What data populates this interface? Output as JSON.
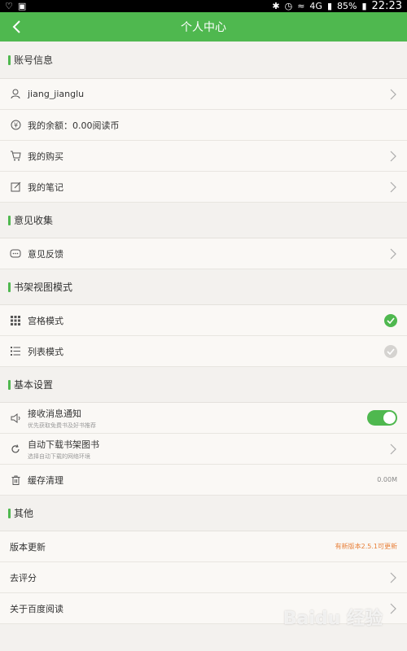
{
  "statusbar": {
    "battery": "85%",
    "network": "4G",
    "time": "22:23"
  },
  "titlebar": {
    "title": "个人中心"
  },
  "sections": {
    "account": {
      "title": "账号信息",
      "username": "jiang_jianglu",
      "balance": "我的余额：0.00阅读币",
      "purchases": "我的购买",
      "notes": "我的笔记"
    },
    "feedback": {
      "title": "意见收集",
      "feedback": "意见反馈"
    },
    "shelf_view": {
      "title": "书架视图模式",
      "grid": "宫格模式",
      "list": "列表模式"
    },
    "basic": {
      "title": "基本设置",
      "notify": "接收消息通知",
      "notify_sub": "优先获取免费书及好书推荐",
      "autodownload": "自动下载书架图书",
      "autodownload_sub": "选择自动下载的网络环境",
      "cache": "缓存清理",
      "cache_size": "0.00M"
    },
    "other": {
      "title": "其他",
      "update": "版本更新",
      "update_note": "有新版本2.5.1可更新",
      "rate": "去评分",
      "about": "关于百度阅读"
    }
  },
  "watermark": "Baidu 经验"
}
